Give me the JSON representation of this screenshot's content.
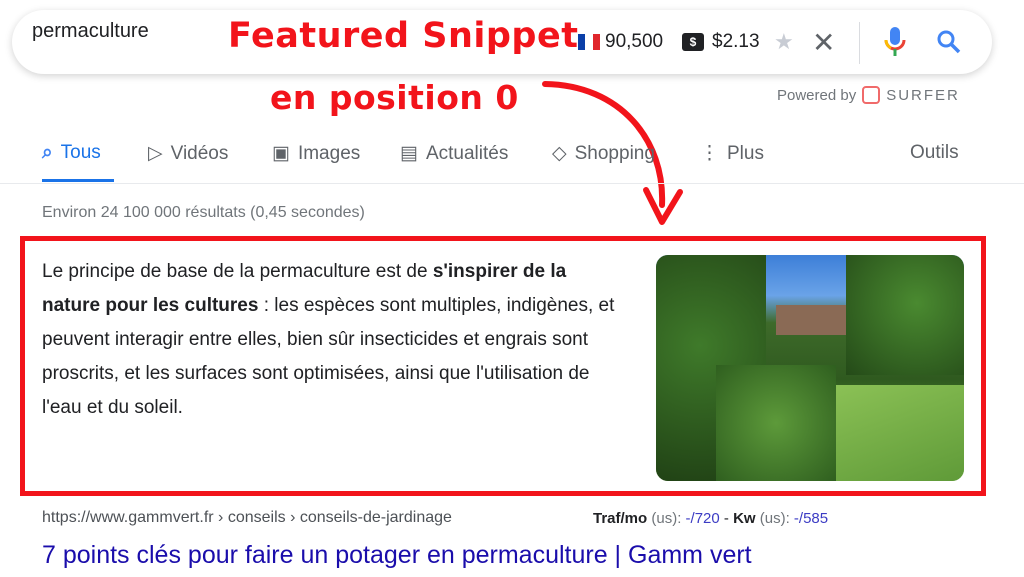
{
  "search": {
    "query": "permaculture",
    "volume": "90,500",
    "cpc": "$2.13",
    "flag": "france-flag-icon"
  },
  "annotation": {
    "line1": "Featured Snippet",
    "line2": "en position 0",
    "color": "#f2141b"
  },
  "powered": {
    "label": "Powered by",
    "brand": "SURFER"
  },
  "tabs": [
    {
      "label": "Tous"
    },
    {
      "label": "Vidéos"
    },
    {
      "label": "Images"
    },
    {
      "label": "Actualités"
    },
    {
      "label": "Shopping"
    },
    {
      "label": "Plus"
    }
  ],
  "tools": "Outils",
  "stats": "Environ 24 100 000 résultats (0,45 secondes)",
  "snippet": {
    "pre": "Le principe de base de la permaculture est de ",
    "bold": "s'inspirer de la nature pour les cultures",
    "post": " : les espèces sont multiples, indigènes, et peuvent interagir entre elles, bien sûr insecticides et engrais sont proscrits, et les surfaces sont optimisées, ainsi que l'utilisation de l'eau et du soleil."
  },
  "result": {
    "url": "https://www.gammvert.fr › conseils › conseils-de-jardinage",
    "traf_label": "Traf/mo",
    "traf_unit": " (us): ",
    "traf_value": "-/720",
    "sep": " - ",
    "kw_label": "Kw",
    "kw_unit": " (us): ",
    "kw_value": "-/585",
    "title": "7 points clés pour faire un potager en permaculture | Gamm vert"
  },
  "colors": {
    "link": "#1a0dab",
    "accent": "#1a73e8"
  }
}
